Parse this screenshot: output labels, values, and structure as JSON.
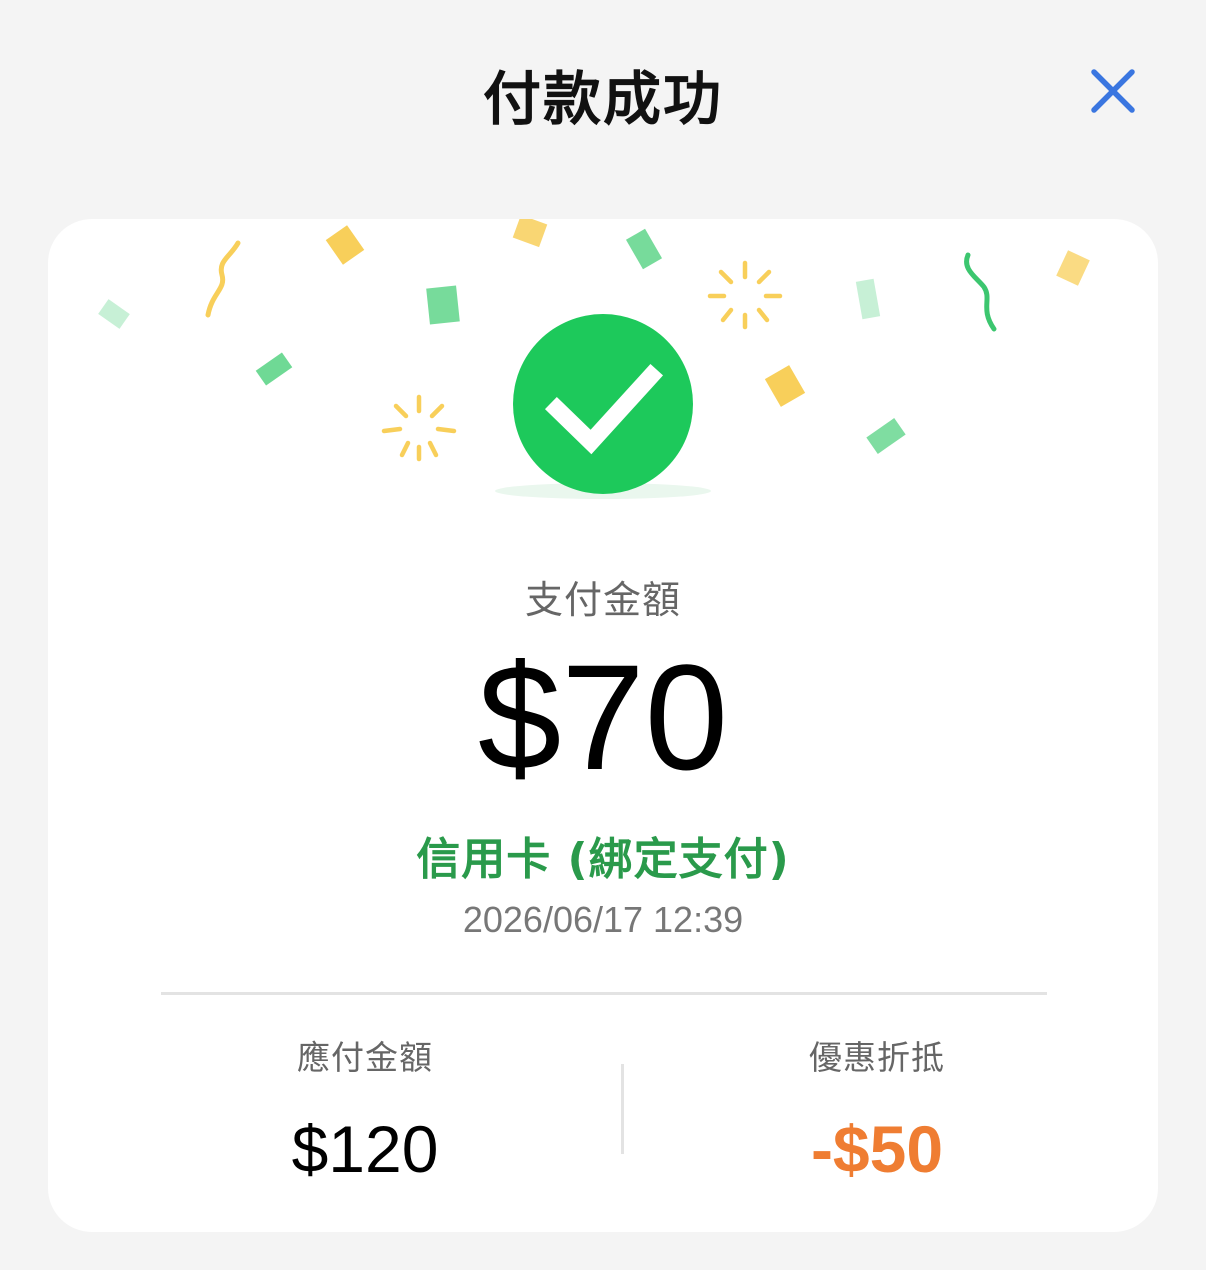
{
  "header": {
    "title": "付款成功",
    "close_icon": "close-icon"
  },
  "colors": {
    "success_green": "#1dc95b",
    "method_green": "#2a9a4b",
    "discount_orange": "#ef7d32",
    "close_blue": "#3a76e0",
    "confetti_yellow": "#f8cf5a",
    "confetti_green": "#5fd58a"
  },
  "summary": {
    "amount_label": "支付金額",
    "amount_value": "$70",
    "payment_method": "信用卡 (綁定支付)",
    "timestamp": "2026/06/17 12:39",
    "status_icon": "checkmark-circle-icon"
  },
  "breakdown": {
    "payable_label": "應付金額",
    "payable_value": "$120",
    "discount_label": "優惠折抵",
    "discount_value": "-$50"
  }
}
